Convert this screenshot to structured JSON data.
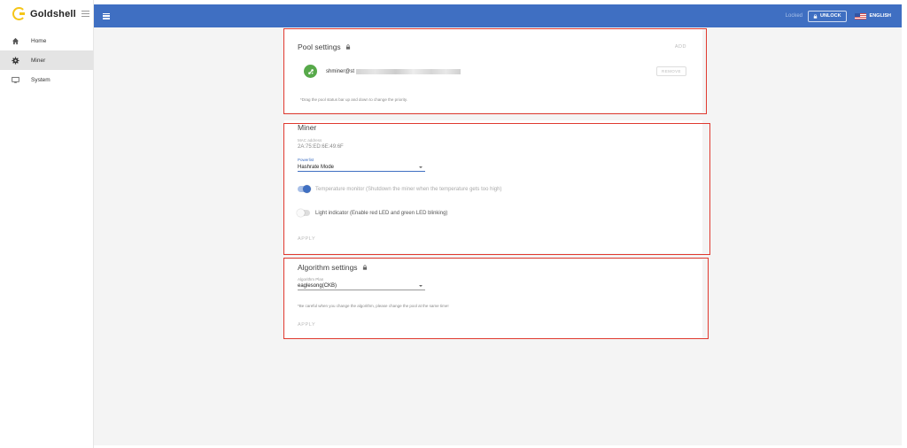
{
  "app": {
    "brand": "Goldshell"
  },
  "sidebar": {
    "items": [
      {
        "label": "Home",
        "icon": "home-icon"
      },
      {
        "label": "Miner",
        "icon": "gear-icon",
        "active": true
      },
      {
        "label": "System",
        "icon": "monitor-icon"
      }
    ]
  },
  "topbar": {
    "status": "Locked",
    "unlock_label": "UNLOCK",
    "language_label": "ENGLISH",
    "accent_color": "#3f6fc2"
  },
  "pool_settings": {
    "title": "Pool settings",
    "add_label": "ADD",
    "pools": [
      {
        "name": "shminer@st",
        "remove_label": "REMOVE"
      }
    ],
    "hint": "*Drag the pool status bar up and down to change the priority."
  },
  "miner": {
    "title": "Miner",
    "mac_label": "MAC address",
    "mac_value": "2A:75:ED:6E:49:6F",
    "powerlist_label": "Powerlist",
    "powerlist_value": "Hashrate Mode",
    "temperature_monitor": {
      "label": "Temperature monitor  (Shutdown the miner when the temperature gets too high)",
      "enabled": true
    },
    "light_indicator": {
      "label": "Light indicator  (Enable red LED and green LED blinking)",
      "enabled": false
    },
    "apply_label": "APPLY"
  },
  "algorithm": {
    "title": "Algorithm settings",
    "plan_label": "Algorithm Plan",
    "plan_value": "eaglesong(CKB)",
    "hint": "*Be careful when you change the algorithm, please change the pool at the same time!",
    "apply_label": "APPLY"
  },
  "colors": {
    "highlight": "#e0392f",
    "pool_avatar": "#57a94a",
    "logo": "#f5c518"
  }
}
